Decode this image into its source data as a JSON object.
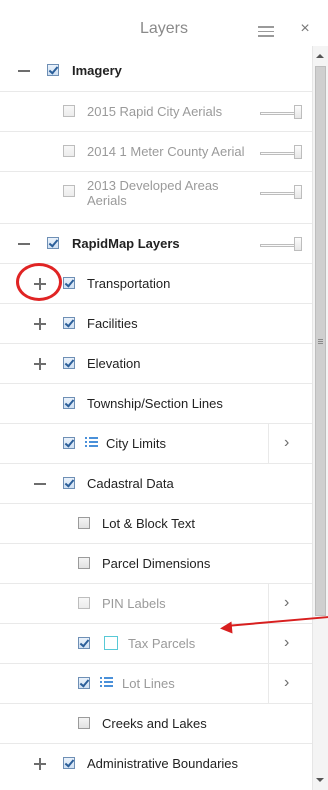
{
  "header": {
    "title": "Layers",
    "menu_icon": "hamburger-menu-icon",
    "close_label": "×"
  },
  "layers": {
    "imagery": {
      "label": "Imagery",
      "checked": true,
      "expanded": true
    },
    "rapid_city_2015": {
      "label": "2015 Rapid City Aerials",
      "checked": false
    },
    "county_2014": {
      "label": "2014 1 Meter County Aerial",
      "checked": false
    },
    "developed_2013": {
      "label": "2013 Developed Areas Aerials",
      "checked": false
    },
    "rapidmap": {
      "label": "RapidMap Layers",
      "checked": true,
      "expanded": true
    },
    "transportation": {
      "label": "Transportation",
      "checked": true
    },
    "facilities": {
      "label": "Facilities",
      "checked": true
    },
    "elevation": {
      "label": "Elevation",
      "checked": true
    },
    "township": {
      "label": "Township/Section Lines",
      "checked": true
    },
    "city_limits": {
      "label": "City Limits",
      "checked": true
    },
    "cadastral": {
      "label": "Cadastral Data",
      "checked": true,
      "expanded": true
    },
    "lot_block": {
      "label": "Lot & Block Text",
      "checked": false
    },
    "parcel_dims": {
      "label": "Parcel Dimensions",
      "checked": false
    },
    "pin_labels": {
      "label": "PIN Labels",
      "checked": false
    },
    "tax_parcels": {
      "label": "Tax Parcels",
      "checked": true
    },
    "lot_lines": {
      "label": "Lot Lines",
      "checked": true
    },
    "creeks": {
      "label": "Creeks and Lakes",
      "checked": false
    },
    "admin": {
      "label": "Administrative Boundaries",
      "checked": true
    }
  },
  "chevron": "›",
  "colors": {
    "checkbox_checked": "#2b5f9a",
    "annotation": "#e02424",
    "tax_parcel_symbol": "#58c9d6",
    "legend_symbol": "#4a90d9"
  }
}
